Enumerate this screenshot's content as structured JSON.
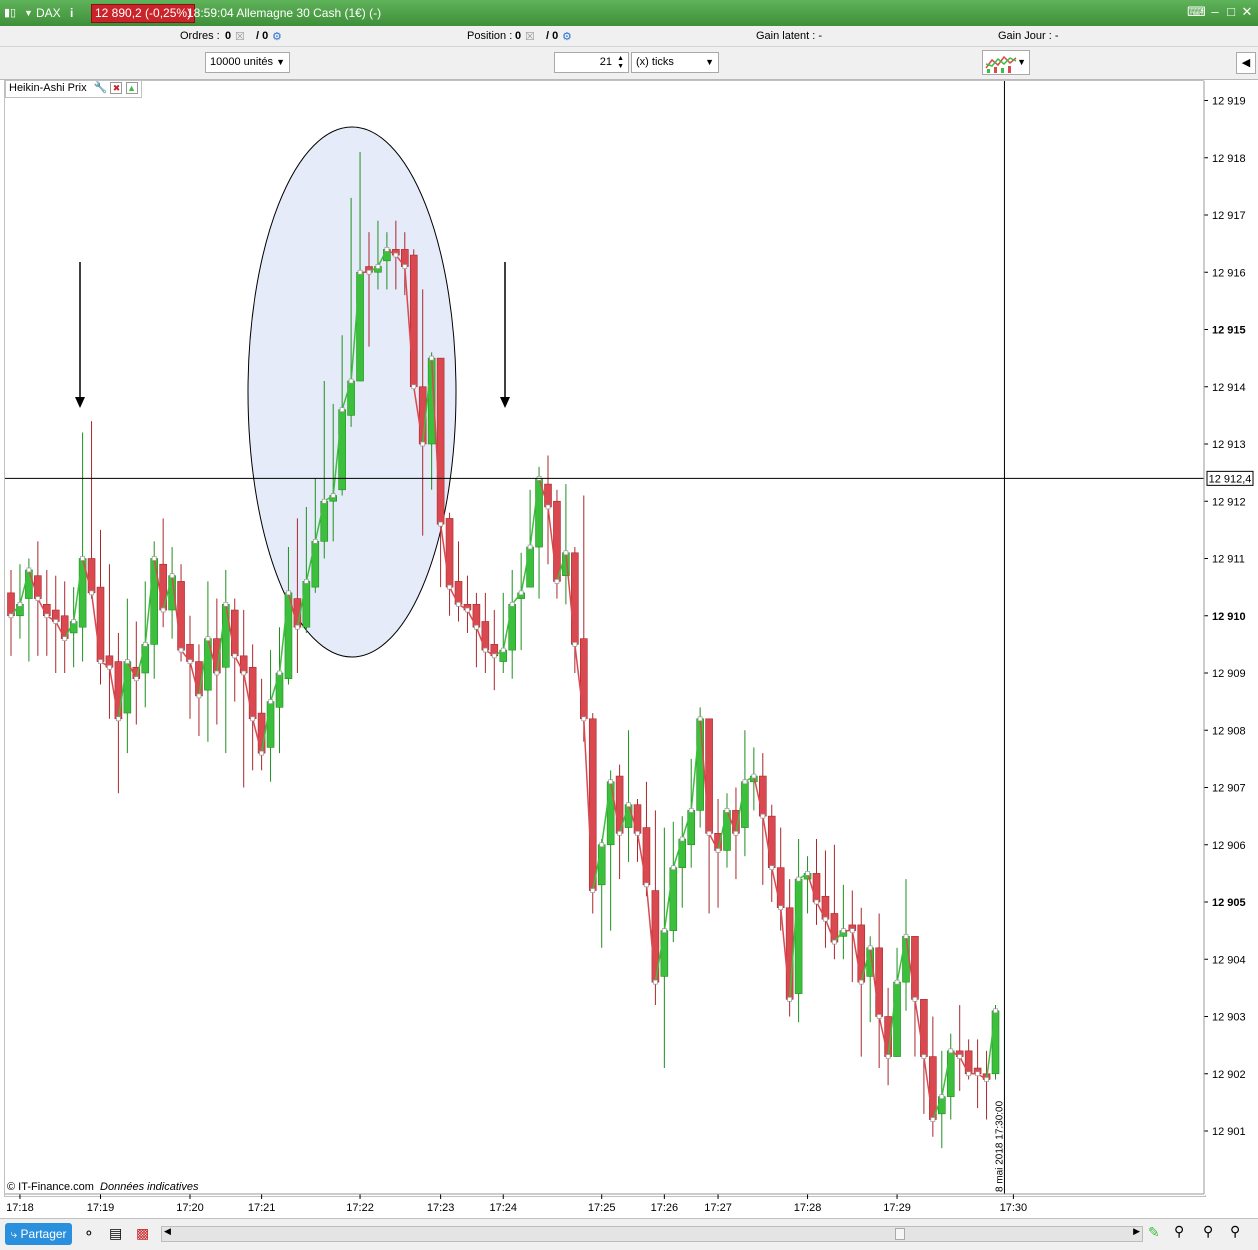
{
  "titlebar": {
    "instrument": "DAX",
    "price_change": "12 890,2 (-0,25%)",
    "time_name": "18:59:04 Allemagne 30 Cash (1€) (-)"
  },
  "infobar": {
    "orders_label": "Ordres :",
    "orders_a": "0",
    "orders_b": "/ 0",
    "position_label": "Position :",
    "position_a": "0",
    "position_b": "/ 0",
    "gain_latent": "Gain latent :  -",
    "gain_jour": "Gain Jour :  -"
  },
  "controls": {
    "units": "10000 unités",
    "ticks_count": "21",
    "ticks_unit": "(x) ticks"
  },
  "indicator_label": "Heikin-Ashi Prix",
  "footer": {
    "copyright": "© IT-Finance.com",
    "disclaimer": "Données indicatives",
    "share_label": "Partager"
  },
  "cursor": {
    "price_label": "12 912,4",
    "date_label": "8 mai 2018 17:30:00"
  },
  "chart_data": {
    "type": "candlestick",
    "title": "Heikin-Ashi Prix",
    "ylim": [
      12900.2,
      12919.3
    ],
    "yticks": [
      12901,
      12902,
      12903,
      12904,
      12905,
      12906,
      12907,
      12908,
      12909,
      12910,
      12911,
      12912,
      12913,
      12914,
      12915,
      12916,
      12917,
      12918,
      12919
    ],
    "ytick_labels": [
      "12 901",
      "12 902",
      "12 903",
      "12 904",
      "12 905",
      "12 906",
      "12 907",
      "12 908",
      "12 909",
      "12 910",
      "12 911",
      "12 912",
      "12 913",
      "12 914",
      "12 915",
      "12 916",
      "12 917",
      "12 918",
      "12 919"
    ],
    "ytick_bold": [
      "12 905",
      "12 910",
      "12 915"
    ],
    "xtick_labels": [
      {
        "label": "17:18",
        "bar": 1
      },
      {
        "label": "17:19",
        "bar": 10
      },
      {
        "label": "17:20",
        "bar": 20
      },
      {
        "label": "17:21",
        "bar": 28
      },
      {
        "label": "17:22",
        "bar": 39
      },
      {
        "label": "17:23",
        "bar": 48
      },
      {
        "label": "17:24",
        "bar": 55
      },
      {
        "label": "17:25",
        "bar": 66
      },
      {
        "label": "17:26",
        "bar": 73
      },
      {
        "label": "17:27",
        "bar": 79
      },
      {
        "label": "17:28",
        "bar": 89
      },
      {
        "label": "17:29",
        "bar": 99
      },
      {
        "label": "17:30",
        "bar": 112
      }
    ],
    "cursor_price": 12912.4,
    "cursor_bar": 111,
    "colors": {
      "up": "#3cbf3c",
      "down": "#d9494f",
      "close_line_up": "#3cbf3c",
      "close_line_down": "#d9494f"
    },
    "candles": [
      [
        12910.4,
        12910.0,
        12910.8,
        12909.3
      ],
      [
        12910.0,
        12910.2,
        12910.9,
        12909.6
      ],
      [
        12910.3,
        12910.8,
        12911.0,
        12909.2
      ],
      [
        12910.7,
        12910.3,
        12911.3,
        12909.3
      ],
      [
        12910.2,
        12910.0,
        12910.8,
        12909.3
      ],
      [
        12910.1,
        12909.9,
        12910.7,
        12909.0
      ],
      [
        12910.0,
        12909.6,
        12910.6,
        12909.0
      ],
      [
        12909.7,
        12909.9,
        12910.5,
        12909.1
      ],
      [
        12909.8,
        12911.0,
        12913.2,
        12909.2
      ],
      [
        12911.0,
        12910.4,
        12913.4,
        12910.3
      ],
      [
        12910.5,
        12909.2,
        12911.5,
        12908.8
      ],
      [
        12909.3,
        12909.1,
        12910.9,
        12908.2
      ],
      [
        12909.2,
        12908.2,
        12909.7,
        12906.9
      ],
      [
        12908.3,
        12909.2,
        12910.3,
        12907.6
      ],
      [
        12909.1,
        12908.9,
        12909.9,
        12908.1
      ],
      [
        12909.0,
        12909.5,
        12910.6,
        12908.4
      ],
      [
        12909.5,
        12911.0,
        12911.3,
        12908.9
      ],
      [
        12910.9,
        12910.1,
        12911.7,
        12909.8
      ],
      [
        12910.1,
        12910.7,
        12911.2,
        12909.6
      ],
      [
        12910.6,
        12909.4,
        12910.9,
        12909.2
      ],
      [
        12909.5,
        12909.2,
        12910.0,
        12908.2
      ],
      [
        12909.2,
        12908.6,
        12909.5,
        12907.9
      ],
      [
        12908.7,
        12909.6,
        12910.6,
        12907.8
      ],
      [
        12909.6,
        12909.0,
        12910.3,
        12908.1
      ],
      [
        12909.1,
        12910.2,
        12910.8,
        12907.6
      ],
      [
        12910.1,
        12909.3,
        12910.3,
        12908.5
      ],
      [
        12909.3,
        12909.0,
        12910.1,
        12907.0
      ],
      [
        12909.1,
        12908.2,
        12909.5,
        12907.3
      ],
      [
        12908.3,
        12907.6,
        12908.9,
        12907.3
      ],
      [
        12907.7,
        12908.5,
        12909.4,
        12907.1
      ],
      [
        12908.4,
        12909.0,
        12909.8,
        12907.6
      ],
      [
        12908.9,
        12910.4,
        12911.2,
        12908.8
      ],
      [
        12910.3,
        12909.8,
        12911.7,
        12909.0
      ],
      [
        12909.8,
        12910.6,
        12911.9,
        12909.7
      ],
      [
        12910.5,
        12911.3,
        12912.4,
        12910.4
      ],
      [
        12911.3,
        12912.0,
        12914.1,
        12911.0
      ],
      [
        12912.0,
        12912.1,
        12913.7,
        12911.3
      ],
      [
        12912.2,
        12913.6,
        12914.9,
        12912.1
      ],
      [
        12913.5,
        12914.1,
        12917.3,
        12913.3
      ],
      [
        12914.1,
        12916.0,
        12918.1,
        12914.1
      ],
      [
        12916.1,
        12916.0,
        12916.7,
        12914.7
      ],
      [
        12916.0,
        12916.1,
        12916.9,
        12915.7
      ],
      [
        12916.2,
        12916.4,
        12916.7,
        12915.7
      ],
      [
        12916.4,
        12916.3,
        12916.9,
        12915.7
      ],
      [
        12916.4,
        12916.1,
        12916.7,
        12915.6
      ],
      [
        12916.3,
        12914.0,
        12916.4,
        12914.0
      ],
      [
        12914.0,
        12913.0,
        12915.7,
        12911.4
      ],
      [
        12913.0,
        12914.5,
        12914.6,
        12912.2
      ],
      [
        12914.5,
        12911.6,
        12914.5,
        12910.5
      ],
      [
        12911.7,
        12910.5,
        12911.8,
        12910.0
      ],
      [
        12910.6,
        12910.2,
        12911.3,
        12909.9
      ],
      [
        12910.2,
        12910.1,
        12910.7,
        12909.7
      ],
      [
        12910.2,
        12909.8,
        12910.4,
        12909.1
      ],
      [
        12909.9,
        12909.4,
        12910.4,
        12909.0
      ],
      [
        12909.5,
        12909.3,
        12910.1,
        12908.7
      ],
      [
        12909.2,
        12909.4,
        12910.4,
        12909.0
      ],
      [
        12909.4,
        12910.2,
        12910.8,
        12908.9
      ],
      [
        12910.3,
        12910.4,
        12911.1,
        12909.4
      ],
      [
        12910.5,
        12911.2,
        12912.2,
        12910.5
      ],
      [
        12911.2,
        12912.4,
        12912.6,
        12910.3
      ],
      [
        12912.3,
        12911.9,
        12912.8,
        12910.9
      ],
      [
        12912.0,
        12910.6,
        12912.2,
        12910.3
      ],
      [
        12910.7,
        12911.1,
        12912.3,
        12910.2
      ],
      [
        12911.1,
        12909.5,
        12911.2,
        12909.0
      ],
      [
        12909.6,
        12908.2,
        12912.1,
        12907.8
      ],
      [
        12908.2,
        12905.2,
        12908.3,
        12904.8
      ],
      [
        12905.3,
        12906.0,
        12906.1,
        12904.2
      ],
      [
        12906.0,
        12907.1,
        12907.3,
        12904.5
      ],
      [
        12907.2,
        12906.2,
        12907.4,
        12905.4
      ],
      [
        12906.3,
        12906.7,
        12908.0,
        12905.7
      ],
      [
        12906.7,
        12906.2,
        12906.8,
        12905.7
      ],
      [
        12906.3,
        12905.3,
        12907.1,
        12905.1
      ],
      [
        12905.2,
        12903.6,
        12906.6,
        12903.2
      ],
      [
        12903.7,
        12904.5,
        12906.3,
        12902.1
      ],
      [
        12904.5,
        12905.6,
        12906.4,
        12904.3
      ],
      [
        12905.6,
        12906.1,
        12906.5,
        12904.9
      ],
      [
        12906.0,
        12906.6,
        12907.5,
        12905.6
      ],
      [
        12906.6,
        12908.2,
        12908.4,
        12906.3
      ],
      [
        12908.2,
        12906.2,
        12908.2,
        12904.8
      ],
      [
        12906.2,
        12905.9,
        12906.8,
        12904.9
      ],
      [
        12905.9,
        12906.6,
        12906.9,
        12905.6
      ],
      [
        12906.6,
        12906.2,
        12907.0,
        12905.4
      ],
      [
        12906.3,
        12907.1,
        12908.0,
        12905.8
      ],
      [
        12907.1,
        12907.2,
        12907.7,
        12906.6
      ],
      [
        12907.2,
        12906.5,
        12907.6,
        12905.3
      ],
      [
        12906.5,
        12905.6,
        12906.7,
        12905.0
      ],
      [
        12905.6,
        12904.9,
        12906.3,
        12904.5
      ],
      [
        12904.9,
        12903.3,
        12905.4,
        12903.0
      ],
      [
        12903.4,
        12905.4,
        12906.1,
        12902.9
      ],
      [
        12905.4,
        12905.5,
        12905.8,
        12904.8
      ],
      [
        12905.5,
        12905.0,
        12906.1,
        12904.6
      ],
      [
        12905.1,
        12904.7,
        12905.9,
        12904.2
      ],
      [
        12904.8,
        12904.3,
        12906.0,
        12904.0
      ],
      [
        12904.4,
        12904.5,
        12905.3,
        12904.0
      ],
      [
        12904.6,
        12904.5,
        12905.2,
        12903.6
      ],
      [
        12904.6,
        12903.6,
        12904.9,
        12902.3
      ],
      [
        12903.7,
        12904.2,
        12904.4,
        12902.9
      ],
      [
        12904.2,
        12903.0,
        12904.8,
        12902.1
      ],
      [
        12903.0,
        12902.3,
        12903.5,
        12901.8
      ],
      [
        12902.3,
        12903.6,
        12904.2,
        12902.5
      ],
      [
        12903.6,
        12904.4,
        12905.4,
        12903.1
      ],
      [
        12904.4,
        12903.3,
        12904.4,
        12902.3
      ],
      [
        12903.3,
        12902.3,
        12903.3,
        12901.3
      ],
      [
        12902.3,
        12901.2,
        12903.0,
        12900.9
      ],
      [
        12901.3,
        12901.6,
        12902.4,
        12900.7
      ],
      [
        12901.6,
        12902.4,
        12902.7,
        12901.2
      ],
      [
        12902.4,
        12902.3,
        12903.2,
        12901.7
      ],
      [
        12902.4,
        12902.0,
        12902.6,
        12901.9
      ],
      [
        12902.1,
        12902.0,
        12902.6,
        12901.4
      ],
      [
        12902.0,
        12901.9,
        12902.4,
        12901.2
      ],
      [
        12902.0,
        12903.1,
        12903.2,
        12901.9
      ]
    ]
  }
}
